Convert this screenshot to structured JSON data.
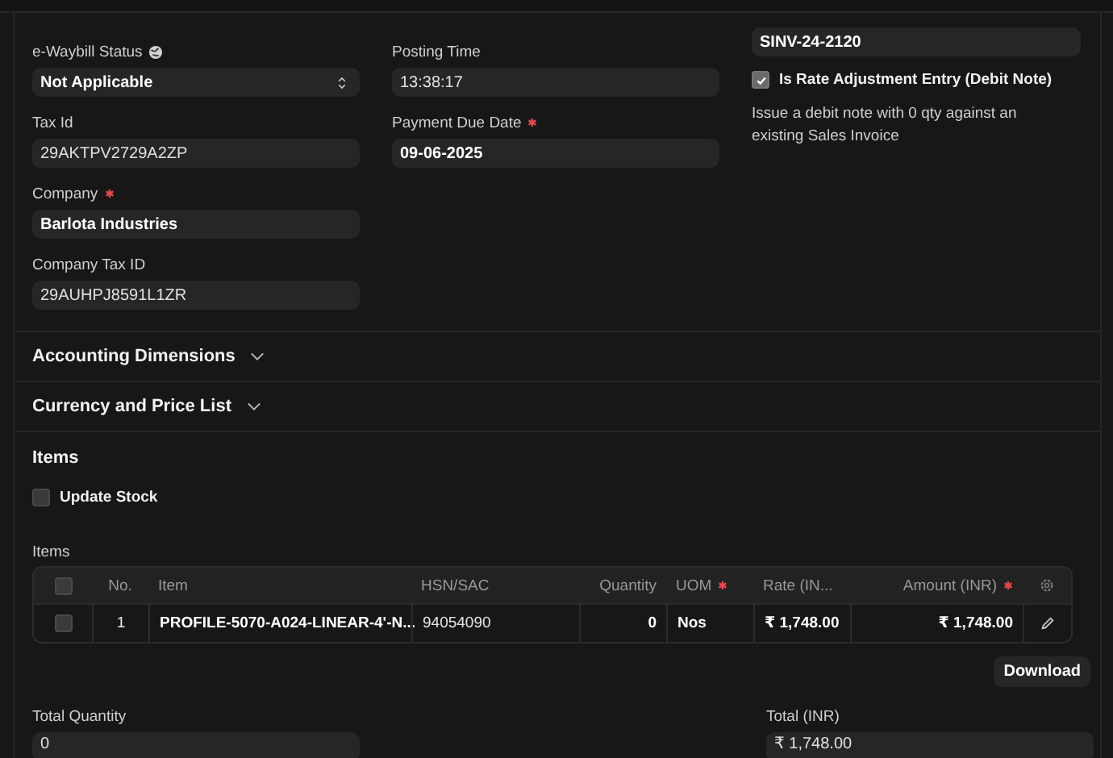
{
  "details": {
    "columns": [
      [
        {
          "kind": "select",
          "label": "e-Waybill Status",
          "info": true,
          "value": "Not Applicable",
          "bold": true
        },
        {
          "kind": "text",
          "label": "Tax Id",
          "value": "29AKTPV2729A2ZP"
        },
        {
          "kind": "text",
          "label": "Company",
          "required": true,
          "value": "Barlota Industries",
          "bold": true
        },
        {
          "kind": "text",
          "label": "Company Tax ID",
          "value": "29AUHPJ8591L1ZR"
        }
      ],
      [
        {
          "kind": "text",
          "label": "Posting Time",
          "value": "13:38:17"
        },
        {
          "kind": "text",
          "label": "Payment Due Date",
          "required": true,
          "value": "09-06-2025",
          "bold": true
        }
      ],
      [
        {
          "kind": "text",
          "value": "SINV-24-2120",
          "bold": true
        },
        {
          "kind": "check",
          "label": "Is Rate Adjustment Entry (Debit Note)",
          "checked": true
        },
        {
          "kind": "note",
          "text": "Issue a debit note with 0 qty against an existing Sales Invoice"
        }
      ]
    ]
  },
  "sections": [
    {
      "title": "Accounting Dimensions",
      "expanded": false
    },
    {
      "title": "Currency and Price List",
      "expanded": false
    }
  ],
  "items": {
    "title": "Items",
    "update_stock": {
      "label": "Update Stock",
      "checked": false
    },
    "table": {
      "label": "Items",
      "select_all": {
        "checked": false
      },
      "columns": [
        {
          "label": "No."
        },
        {
          "label": "Item"
        },
        {
          "label": "HSN/SAC"
        },
        {
          "label": "Quantity"
        },
        {
          "label": "UOM",
          "required": true
        },
        {
          "label": "Rate (IN..."
        },
        {
          "label": "Amount (INR)",
          "required": true
        }
      ],
      "rows": [
        {
          "checked": false,
          "cells": [
            "1",
            "PROFILE-5070-A024-LINEAR-4'-N...",
            "94054090",
            "0",
            "Nos",
            "₹ 1,748.00",
            "₹ 1,748.00"
          ]
        }
      ]
    },
    "download": "Download",
    "totals": [
      {
        "label": "Total Quantity",
        "value": "0"
      },
      {
        "label": "Total (INR)",
        "value": "₹ 1,748.00"
      }
    ]
  }
}
